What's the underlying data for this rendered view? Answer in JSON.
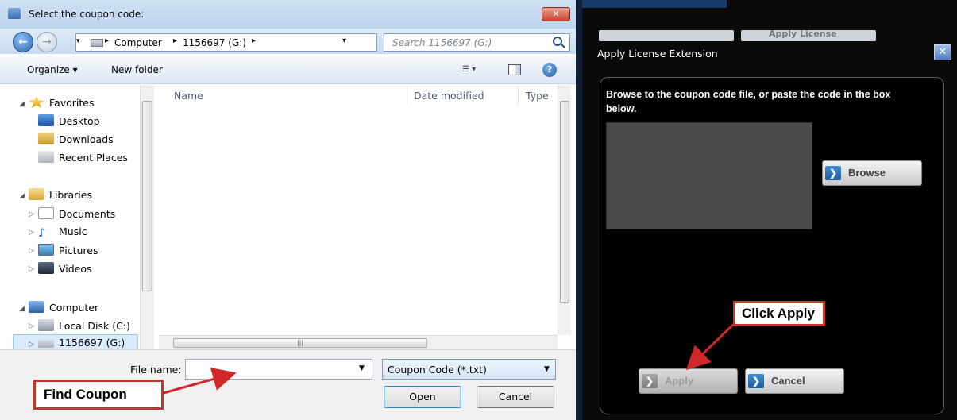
{
  "file_dialog": {
    "title": "Select the coupon code:",
    "close_label": "✕",
    "address": {
      "crumbs": [
        "Computer",
        "1156697 (G:)"
      ]
    },
    "search_placeholder": "Search 1156697 (G:)",
    "toolbar": {
      "organize": "Organize ▾",
      "new_folder": "New folder"
    },
    "nav": {
      "favorites": {
        "label": "Favorites",
        "items": [
          "Desktop",
          "Downloads",
          "Recent Places"
        ]
      },
      "libraries": {
        "label": "Libraries",
        "items": [
          "Documents",
          "Music",
          "Pictures",
          "Videos"
        ]
      },
      "computer": {
        "label": "Computer",
        "items": [
          "Local Disk (C:)",
          "1156697 (G:)"
        ]
      }
    },
    "columns": [
      "Name",
      "Date modified",
      "Type"
    ],
    "file_name_label": "File name:",
    "file_name_value": "",
    "filter": "Coupon Code (*.txt)",
    "open_label": "Open",
    "cancel_label": "Cancel"
  },
  "annotations": {
    "find_coupon": "Find Coupon",
    "click_apply": "Click Apply",
    "color": "#c0392b"
  },
  "license_dialog": {
    "background_button": "Apply License",
    "title": "Apply License Extension",
    "instructions": "Browse to the coupon code file, or paste the code in the box below.",
    "browse_label": "Browse",
    "apply_label": "Apply",
    "cancel_label": "Cancel"
  }
}
